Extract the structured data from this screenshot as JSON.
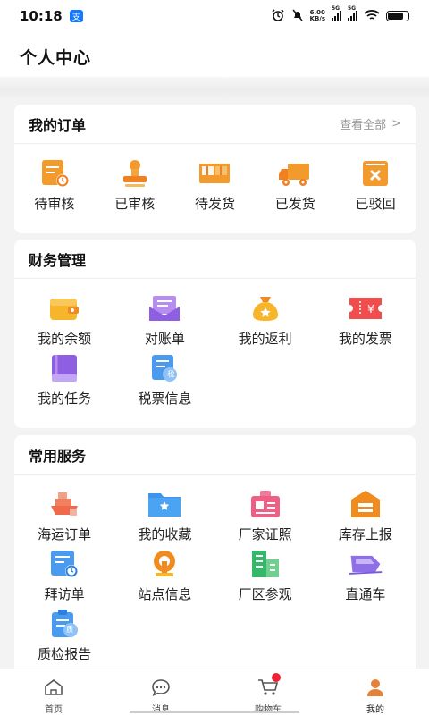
{
  "status": {
    "time": "10:18",
    "app_badge": "支",
    "speed_value": "6.00",
    "speed_unit": "KB/s",
    "sig1": "5G",
    "sig2": "5G",
    "battery_level": 0.75
  },
  "header": {
    "title": "个人中心"
  },
  "orders": {
    "title": "我的订单",
    "view_all": "查看全部",
    "items": [
      {
        "label": "待审核",
        "icon": "pending-review-icon"
      },
      {
        "label": "已审核",
        "icon": "approved-stamp-icon"
      },
      {
        "label": "待发货",
        "icon": "pending-shipment-icon"
      },
      {
        "label": "已发货",
        "icon": "shipped-truck-icon"
      },
      {
        "label": "已驳回",
        "icon": "rejected-icon"
      }
    ]
  },
  "finance": {
    "title": "财务管理",
    "items": [
      {
        "label": "我的余额",
        "icon": "wallet-icon"
      },
      {
        "label": "对账单",
        "icon": "statement-icon"
      },
      {
        "label": "我的返利",
        "icon": "money-bag-icon"
      },
      {
        "label": "我的发票",
        "icon": "invoice-ticket-icon"
      },
      {
        "label": "我的任务",
        "icon": "task-book-icon"
      },
      {
        "label": "税票信息",
        "icon": "tax-receipt-icon"
      }
    ]
  },
  "services": {
    "title": "常用服务",
    "items": [
      {
        "label": "海运订单",
        "icon": "ship-icon"
      },
      {
        "label": "我的收藏",
        "icon": "favorite-folder-icon"
      },
      {
        "label": "厂家证照",
        "icon": "license-id-icon"
      },
      {
        "label": "库存上报",
        "icon": "warehouse-icon"
      },
      {
        "label": "拜访单",
        "icon": "visit-clock-icon"
      },
      {
        "label": "站点信息",
        "icon": "station-icon"
      },
      {
        "label": "厂区参观",
        "icon": "factory-building-icon"
      },
      {
        "label": "直通车",
        "icon": "train-icon"
      },
      {
        "label": "质检报告",
        "icon": "quality-report-icon"
      }
    ],
    "quality_badge": "质",
    "tax_badge": "税"
  },
  "colors": {
    "accent_orange": "#f0821e",
    "accent_purple": "#9b6fe0",
    "accent_blue": "#4a9af0",
    "badge_red": "#ee2233"
  },
  "tabbar": {
    "tabs": [
      {
        "label": "首页",
        "icon": "home-icon"
      },
      {
        "label": "消息",
        "icon": "message-icon"
      },
      {
        "label": "购物车",
        "icon": "cart-icon"
      },
      {
        "label": "我的",
        "icon": "profile-icon"
      }
    ]
  }
}
